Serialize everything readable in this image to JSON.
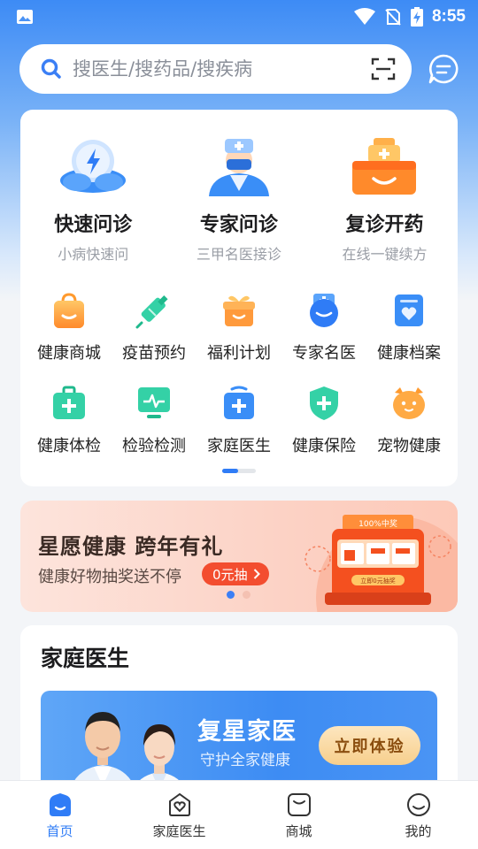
{
  "status_bar": {
    "time": "8:55"
  },
  "search": {
    "placeholder": "搜医生/搜药品/搜疾病"
  },
  "main_services": [
    {
      "title": "快速问诊",
      "subtitle": "小病快速问",
      "icon": "lightning-cloud-icon"
    },
    {
      "title": "专家问诊",
      "subtitle": "三甲名医接诊",
      "icon": "doctor-icon"
    },
    {
      "title": "复诊开药",
      "subtitle": "在线一键续方",
      "icon": "medicine-box-icon"
    }
  ],
  "grid_services": [
    {
      "label": "健康商城",
      "icon": "shopping-bag-icon"
    },
    {
      "label": "疫苗预约",
      "icon": "syringe-icon"
    },
    {
      "label": "福利计划",
      "icon": "gift-icon"
    },
    {
      "label": "专家名医",
      "icon": "doctor-cap-icon"
    },
    {
      "label": "健康档案",
      "icon": "health-file-icon"
    },
    {
      "label": "健康体检",
      "icon": "medical-kit-icon"
    },
    {
      "label": "检验检测",
      "icon": "monitor-icon"
    },
    {
      "label": "家庭医生",
      "icon": "family-doctor-icon"
    },
    {
      "label": "健康保险",
      "icon": "shield-icon"
    },
    {
      "label": "宠物健康",
      "icon": "pet-icon"
    }
  ],
  "promo_banner": {
    "title": "星愿健康 跨年有礼",
    "subtitle": "健康好物抽奖送不停",
    "button": "0元抽",
    "art_text_top": "100%中奖",
    "art_text_button": "立即0元抽奖"
  },
  "family_section": {
    "title": "家庭医生",
    "banner_title": "复星家医",
    "banner_subtitle": "守护全家健康",
    "banner_button": "立即体验"
  },
  "tabs": [
    {
      "label": "首页",
      "icon": "home-icon",
      "active": true
    },
    {
      "label": "家庭医生",
      "icon": "heart-house-icon",
      "active": false
    },
    {
      "label": "商城",
      "icon": "mall-icon",
      "active": false
    },
    {
      "label": "我的",
      "icon": "smile-icon",
      "active": false
    }
  ],
  "colors": {
    "primary": "#2f7cf6",
    "promo_button": "#f34d2f",
    "gold_button": "#f7cf8c"
  }
}
